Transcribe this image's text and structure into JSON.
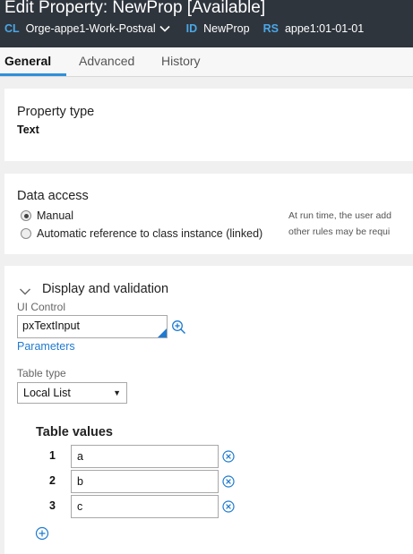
{
  "header": {
    "title": "Edit Property: NewProp [Available]",
    "class_key": "CL",
    "class_value": "Orge-appe1-Work-Postval",
    "id_key": "ID",
    "id_value": "NewProp",
    "rs_key": "RS",
    "rs_value": "appe1:01-01-01"
  },
  "tabs": [
    {
      "label": "General",
      "active": true
    },
    {
      "label": "Advanced",
      "active": false
    },
    {
      "label": "History",
      "active": false
    }
  ],
  "property_type": {
    "heading": "Property type",
    "value": "Text"
  },
  "data_access": {
    "heading": "Data access",
    "options": [
      {
        "label": "Manual",
        "selected": true
      },
      {
        "label": "Automatic reference to class instance (linked)",
        "selected": false
      }
    ],
    "hint_lines": [
      "At run time, the user add",
      "other rules may be requi"
    ]
  },
  "display_validation": {
    "heading": "Display and validation",
    "ui_control_label": "UI Control",
    "ui_control_value": "pxTextInput",
    "parameters_link": "Parameters",
    "table_type_label": "Table type",
    "table_type_value": "Local List",
    "table_values_heading": "Table values",
    "table_values": [
      {
        "index": "1",
        "value": "a"
      },
      {
        "index": "2",
        "value": "b"
      },
      {
        "index": "3",
        "value": "c"
      }
    ]
  },
  "colors": {
    "header_bg": "#2f353d",
    "accent": "#1f7ad1",
    "tab_underline": "#2f8fd9",
    "key_blue": "#4aa8e8"
  },
  "icons": [
    "chevron-down-icon",
    "zoom-in-icon",
    "remove-circle-icon",
    "add-circle-icon"
  ]
}
